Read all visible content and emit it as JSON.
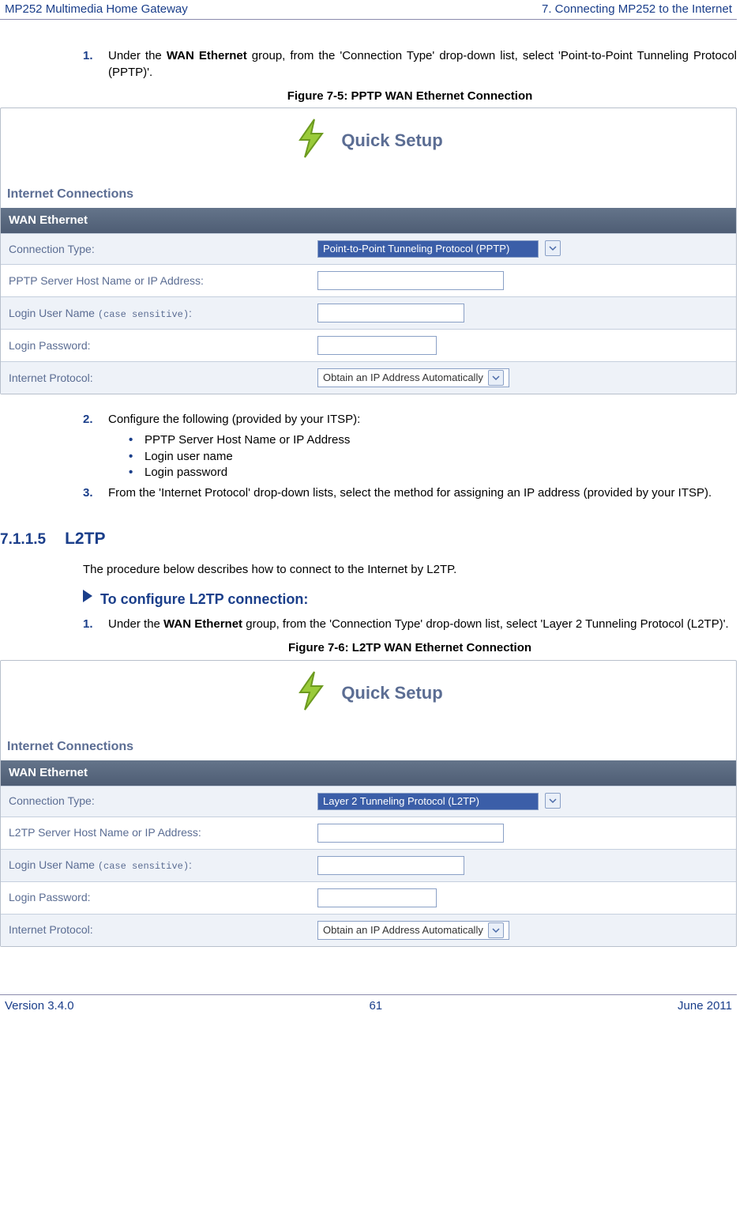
{
  "header": {
    "left": "MP252 Multimedia Home Gateway",
    "right": "7. Connecting MP252 to the Internet"
  },
  "step1_num": "1.",
  "step1_text_pre": "Under the ",
  "step1_bold": "WAN Ethernet",
  "step1_text_post": " group, from the 'Connection Type' drop-down list, select 'Point-to-Point Tunneling Protocol (PPTP)'.",
  "fig1_caption": "Figure 7-5: PPTP WAN Ethernet Connection",
  "panel_common": {
    "title": "Quick Setup",
    "section": "Internet Connections",
    "band": "WAN Ethernet",
    "row_connection_type": "Connection Type:",
    "row_login_user": "Login User Name ",
    "row_login_user_cs": "(case sensitive)",
    "row_login_user_colon": ":",
    "row_login_pw": "Login Password:",
    "row_ip": "Internet Protocol:",
    "ip_select": "Obtain an IP Address Automatically"
  },
  "panel1": {
    "row_server": "PPTP Server Host Name or IP Address:",
    "conn_select": "Point-to-Point Tunneling Protocol (PPTP)"
  },
  "step2_num": "2.",
  "step2_text": "Configure the following (provided by your ITSP):",
  "bullets": [
    "PPTP Server Host Name or IP Address",
    "Login user name",
    "Login password"
  ],
  "step3_num": "3.",
  "step3_text": "From the 'Internet Protocol' drop-down lists, select the method for assigning an IP address (provided by your ITSP).",
  "h715_num": "7.1.1.5",
  "h715_title": "L2TP",
  "l2tp_intro": "The procedure below describes how to connect to the Internet by L2TP.",
  "proc_title": "To configure L2TP connection:",
  "l2tp_step1_num": "1.",
  "l2tp_step1_pre": "Under the ",
  "l2tp_step1_bold": "WAN Ethernet",
  "l2tp_step1_post": " group, from the 'Connection Type' drop-down list, select 'Layer 2 Tunneling Protocol (L2TP)'.",
  "fig2_caption": "Figure 7-6: L2TP WAN Ethernet Connection",
  "panel2": {
    "row_server": "L2TP Server Host Name or IP Address:",
    "conn_select": "Layer 2 Tunneling Protocol (L2TP)"
  },
  "footer": {
    "left": "Version 3.4.0",
    "center": "61",
    "right": "June 2011"
  }
}
